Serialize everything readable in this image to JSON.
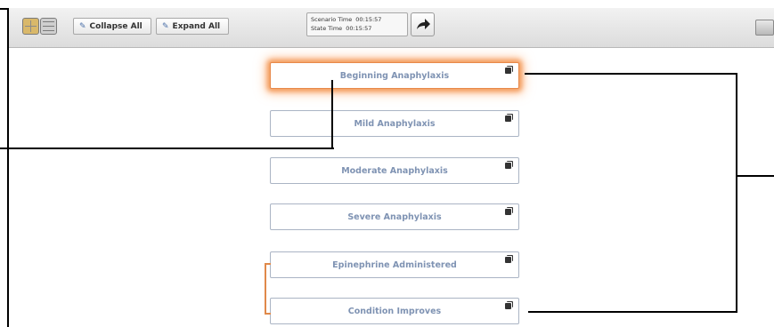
{
  "toolbar": {
    "collapse_label": "Collapse All",
    "expand_label": "Expand All",
    "scenario_time_label": "Scenario Time",
    "scenario_time_value": "00:15:57",
    "state_time_label": "State Time",
    "state_time_value": "00:15:57"
  },
  "icons": {
    "grid_view": "grid-view-icon",
    "list_view": "list-view-icon",
    "collapse": "collapse-icon",
    "expand": "expand-icon",
    "advance": "arrow-right-icon",
    "note": "note-icon"
  },
  "states": [
    {
      "label": "Beginning Anaphylaxis",
      "active": true
    },
    {
      "label": "Mild Anaphylaxis",
      "active": false
    },
    {
      "label": "Moderate Anaphylaxis",
      "active": false
    },
    {
      "label": "Severe Anaphylaxis",
      "active": false
    },
    {
      "label": "Epinephrine Administered",
      "active": false
    },
    {
      "label": "Condition Improves",
      "active": false
    }
  ],
  "colors": {
    "state_text": "#7f93b3",
    "active_glow": "#f29a5a",
    "connector": "#e0894a"
  }
}
